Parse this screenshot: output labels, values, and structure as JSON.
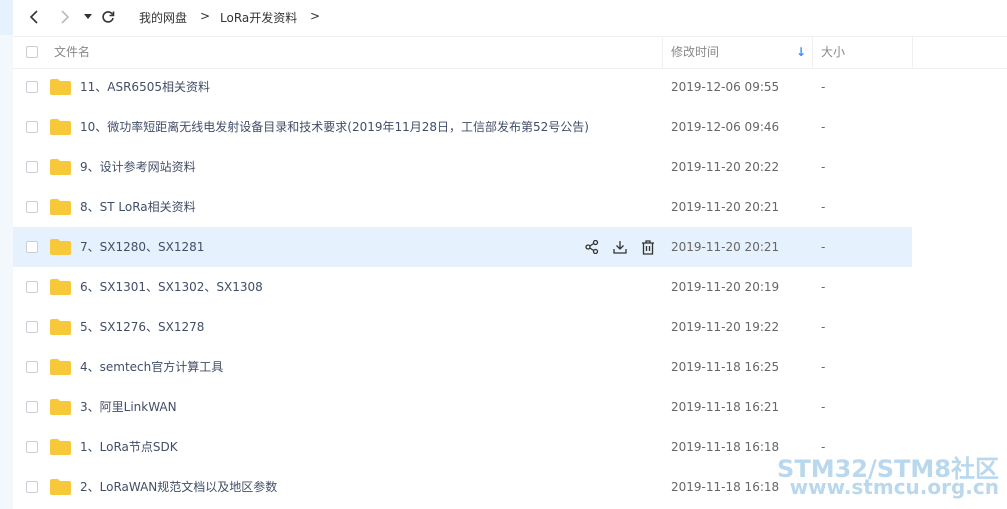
{
  "nav": {
    "breadcrumb": [
      "我的网盘",
      "LoRa开发资料"
    ],
    "separator": ">"
  },
  "header": {
    "name": "文件名",
    "modified": "修改时间",
    "size": "大小",
    "sort_arrow": "↓",
    "sort_color": "#3b8cff"
  },
  "colors": {
    "folder": "#f8c83b",
    "hover_row": "#e5f1fc",
    "sidebar": "#f3f8fd"
  },
  "files": [
    {
      "name": "11、ASR6505相关资料",
      "date": "2019-12-06 09:55",
      "size": "-"
    },
    {
      "name": "10、微功率短距离无线电发射设备目录和技术要求(2019年11月28日，工信部发布第52号公告)",
      "date": "2019-12-06 09:46",
      "size": "-"
    },
    {
      "name": "9、设计参考网站资料",
      "date": "2019-11-20 20:22",
      "size": "-"
    },
    {
      "name": "8、ST LoRa相关资料",
      "date": "2019-11-20 20:21",
      "size": "-"
    },
    {
      "name": "7、SX1280、SX1281",
      "date": "2019-11-20 20:21",
      "size": "-"
    },
    {
      "name": "6、SX1301、SX1302、SX1308",
      "date": "2019-11-20 20:19",
      "size": "-"
    },
    {
      "name": "5、SX1276、SX1278",
      "date": "2019-11-20 19:22",
      "size": "-"
    },
    {
      "name": "4、semtech官方计算工具",
      "date": "2019-11-18 16:25",
      "size": "-"
    },
    {
      "name": "3、阿里LinkWAN",
      "date": "2019-11-18 16:21",
      "size": "-"
    },
    {
      "name": "1、LoRa节点SDK",
      "date": "2019-11-18 16:18",
      "size": "-"
    },
    {
      "name": "2、LoRaWAN规范文档以及地区参数",
      "date": "2019-11-18 16:18",
      "size": "-"
    }
  ],
  "hover_index": 4,
  "row_actions": [
    "share-icon",
    "download-icon",
    "delete-icon"
  ],
  "watermark": {
    "line1": "STM32/STM8社区",
    "line2": "www.stmcu.org.cn"
  }
}
